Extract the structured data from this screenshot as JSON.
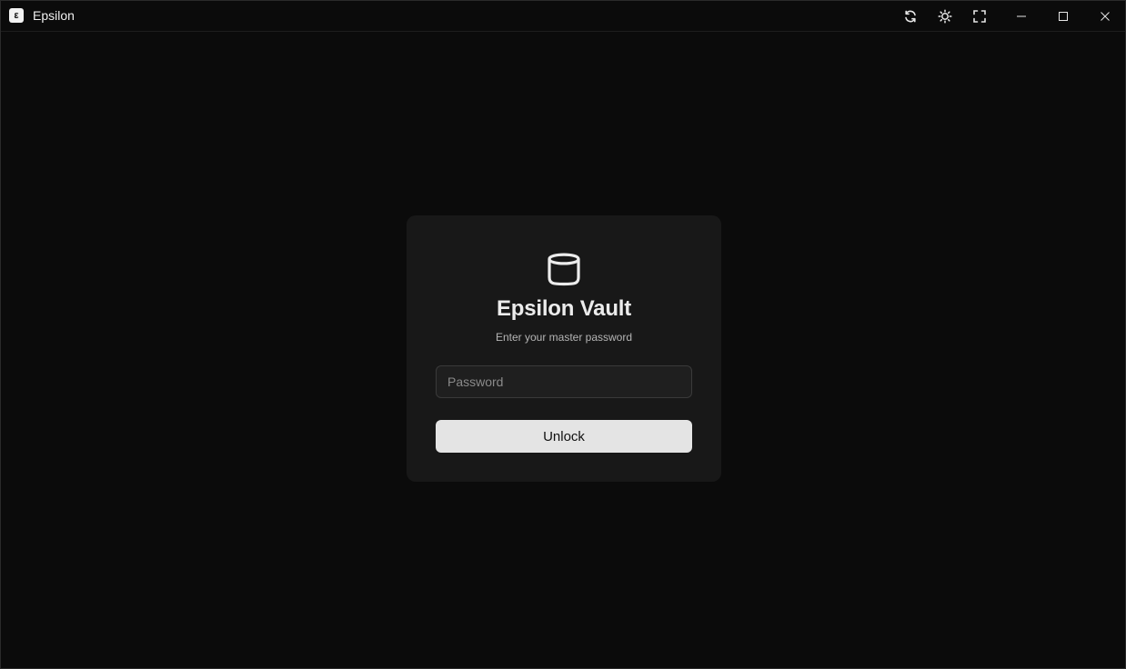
{
  "window": {
    "title": "Epsilon",
    "app_icon_glyph": "ε",
    "controls": [
      "refresh-icon",
      "theme-sun-icon",
      "fullscreen-icon",
      "minimize-icon",
      "maximize-icon",
      "close-icon"
    ]
  },
  "login": {
    "logo_icon": "database-icon",
    "title": "Epsilon Vault",
    "subtitle": "Enter your master password",
    "password_placeholder": "Password",
    "password_value": "",
    "unlock_label": "Unlock"
  },
  "colors": {
    "background": "#0b0b0b",
    "card": "#181818",
    "input_bg": "#1f1f1f",
    "button_bg": "#e4e4e4",
    "text": "#ececec"
  }
}
